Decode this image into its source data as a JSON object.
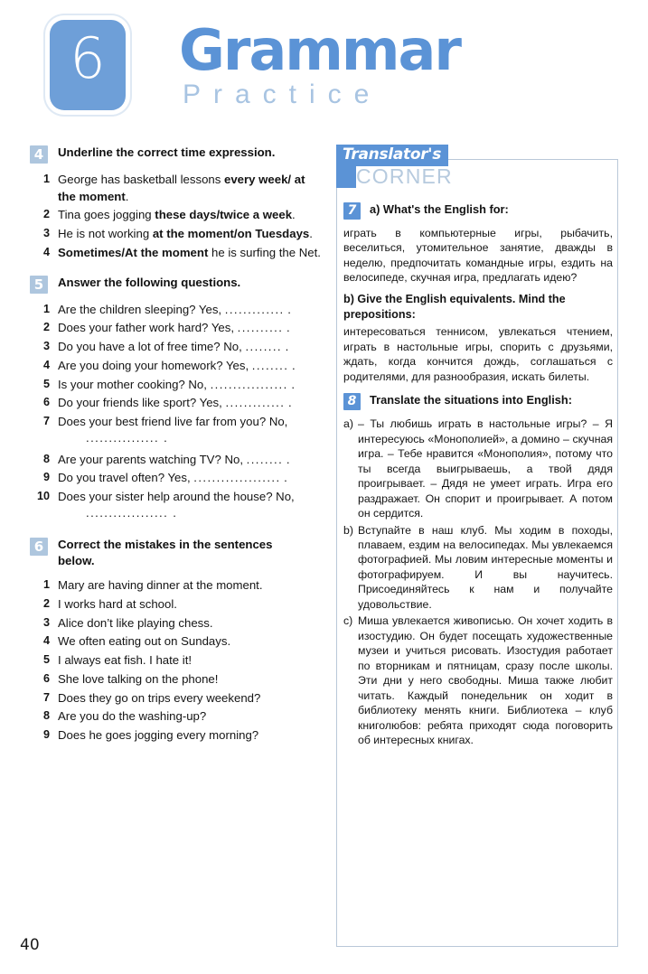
{
  "header": {
    "unit_number": "6",
    "title_main": "Grammar",
    "title_sub": "Practice"
  },
  "page_number": "40",
  "left_column": {
    "exercises": [
      {
        "number": "4",
        "title": "Underline the correct time expression.",
        "items": [
          "George has basketball lessons <b>every week/ at the moment</b>.",
          "Tina goes jogging <b>these days/twice a week</b>.",
          "He is not working <b>at the moment/on Tuesdays</b>.",
          "<b>Sometimes/At the moment</b> he is surfing the Net."
        ]
      },
      {
        "number": "5",
        "title": "Answer the following questions.",
        "items": [
          "Are the children sleeping? Yes, <span class=\"dots\">.............</span> .",
          "Does your father work hard? Yes, <span class=\"dots\">..........</span> .",
          "Do you have a lot of free time? No, <span class=\"dots\">........</span> .",
          "Are you doing your homework? Yes, <span class=\"dots\">........</span> .",
          "Is your mother cooking? No, <span class=\"dots\">.................</span> .",
          "Do your friends like sport? Yes, <span class=\"dots\">.............</span> .",
          "Does your best friend live far from you? No,<span class=\"cont-dots\">................ .</span>",
          "Are your parents watching TV? No, <span class=\"dots\">........</span> .",
          "Do you travel often? Yes, <span class=\"dots\">...................</span> .",
          "Does your sister help around the house? No,<span class=\"cont-dots\">.................. .</span>"
        ]
      },
      {
        "number": "6",
        "title": "Correct the mistakes in the sentences below.",
        "items": [
          "Mary are having dinner at the moment.",
          "I works hard at school.",
          "Alice don&rsquo;t like playing chess.",
          "We often eating out on Sundays.",
          "I always eat fish. I hate it!",
          "She love talking on the phone!",
          "Does they go on trips every weekend?",
          "Are you do the washing-up?",
          "Does he goes jogging every morning?"
        ]
      }
    ]
  },
  "translators_corner": {
    "label_top": "Translator's",
    "label_bottom": "CORNER",
    "exercise7": {
      "number": "7",
      "title_a": "a) What's the English for:",
      "text_a": "играть в компьютерные игры, рыбачить, веселиться, утомительное занятие, дважды в неделю, предпочитать командные игры, ездить на велосипеде, скучная игра, предлагать идею?",
      "title_b": "b) Give the English equivalents. Mind the prepositions:",
      "text_b": "интересоваться теннисом, увлекаться чтением, играть в настольные игры, спорить с друзьями, ждать, когда кончится дождь, соглашаться с родителями, для разнообразия, искать билеты."
    },
    "exercise8": {
      "number": "8",
      "title": "Translate the situations into English:",
      "items": [
        {
          "letter": "a)",
          "text": "– Ты любишь играть в настольные игры? – Я интересуюсь «Монополией», а домино – скучная игра. – Тебе нравится «Монополия», потому что ты всегда выигрываешь, а твой дядя проигрывает. – Дядя не умеет играть. Игра его раздражает. Он спорит и проигрывает. А потом он сердится."
        },
        {
          "letter": "b)",
          "text": "Вступайте в наш клуб. Мы ходим в походы, плаваем, ездим на велосипедах. Мы увлекаемся фотографией. Мы ловим интересные моменты и фотографируем. И вы научитесь. Присоединяйтесь к нам и получайте удовольствие."
        },
        {
          "letter": "c)",
          "text": "Миша увлекается живописью. Он хочет ходить в изостудию. Он будет посещать художественные музеи и учиться рисовать. Изостудия работает по вторникам и пятницам, сразу после школы. Эти дни у него свободны. Миша также любит читать. Каждый понедельник он ходит в библиотеку менять книги. Библиотека – клуб книголюбов: ребята приходят сюда поговорить об интересных книгах."
        }
      ]
    }
  },
  "colors": {
    "brand_blue": "#5b93d6",
    "badge_blue": "#6e9fd8",
    "pale_blue": "#aec6de",
    "corner_text": "#b6cade"
  }
}
